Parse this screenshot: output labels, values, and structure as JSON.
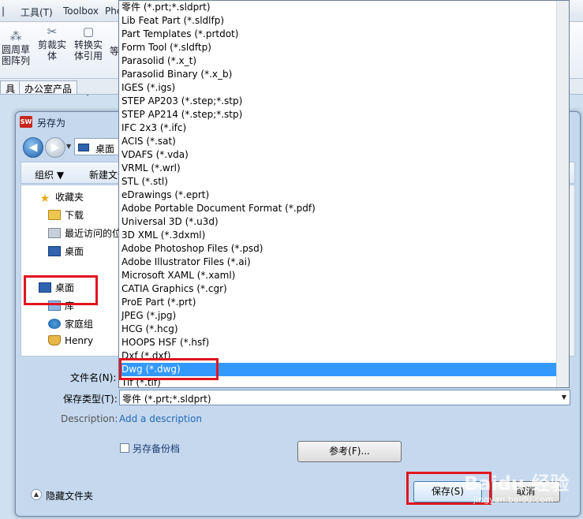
{
  "app": {
    "menubar": {
      "tools": "工具(T)",
      "toolbox": "Toolbox",
      "truncated": "Pho"
    },
    "ribbon": {
      "circular_pattern": "圆周草\n图阵列",
      "trim_entities": "剪裁实\n体",
      "convert_entities": "转换实\n体引用",
      "more": "等"
    },
    "tabs": {
      "tab1": "具",
      "tab2": "办公室产品"
    }
  },
  "dialog": {
    "title": "另存为",
    "address": "桌面",
    "toolbar": {
      "organize": "组织 ▼",
      "new_folder": "新建文件夹"
    },
    "nav_pane": {
      "favorites": "收藏夹",
      "downloads": "下载",
      "recent": "最近访问的位置",
      "desktop_fav": "桌面",
      "desktop": "桌面",
      "libraries": "库",
      "homegroup": "家庭组",
      "user": "Henry"
    },
    "filename_label": "文件名(N):",
    "filetype_label": "保存类型(T):",
    "filetype_value": "零件 (*.prt;*.sldprt)",
    "description_label": "Description:",
    "description_link": "Add a description",
    "backup_label": "另存备份档",
    "browse_button": "参考(F)...",
    "hide_folders": "隐藏文件夹",
    "save_button": "保存(S)",
    "cancel_button": "取消"
  },
  "type_options": [
    "零件 (*.prt;*.sldprt)",
    "Lib Feat Part (*.sldlfp)",
    "Part Templates (*.prtdot)",
    "Form Tool (*.sldftp)",
    "Parasolid (*.x_t)",
    "Parasolid Binary (*.x_b)",
    "IGES (*.igs)",
    "STEP AP203 (*.step;*.stp)",
    "STEP AP214 (*.step;*.stp)",
    "IFC 2x3 (*.ifc)",
    "ACIS (*.sat)",
    "VDAFS (*.vda)",
    "VRML (*.wrl)",
    "STL (*.stl)",
    "eDrawings (*.eprt)",
    "Adobe Portable Document Format (*.pdf)",
    "Universal 3D (*.u3d)",
    "3D XML (*.3dxml)",
    "Adobe Photoshop Files (*.psd)",
    "Adobe Illustrator Files (*.ai)",
    "Microsoft XAML (*.xaml)",
    "CATIA Graphics (*.cgr)",
    "ProE Part (*.prt)",
    "JPEG (*.jpg)",
    "HCG (*.hcg)",
    "HOOPS HSF (*.hsf)",
    "Dxf (*.dxf)",
    "Dwg (*.dwg)",
    "Tif (*.tif)"
  ],
  "selected_option_index": 27,
  "watermark": {
    "main": "Baidu 经验",
    "sub": "jingyan.baidu.com"
  },
  "colors": {
    "highlight": "#e0151f",
    "selection": "#3399ff",
    "link": "#2468b4"
  }
}
